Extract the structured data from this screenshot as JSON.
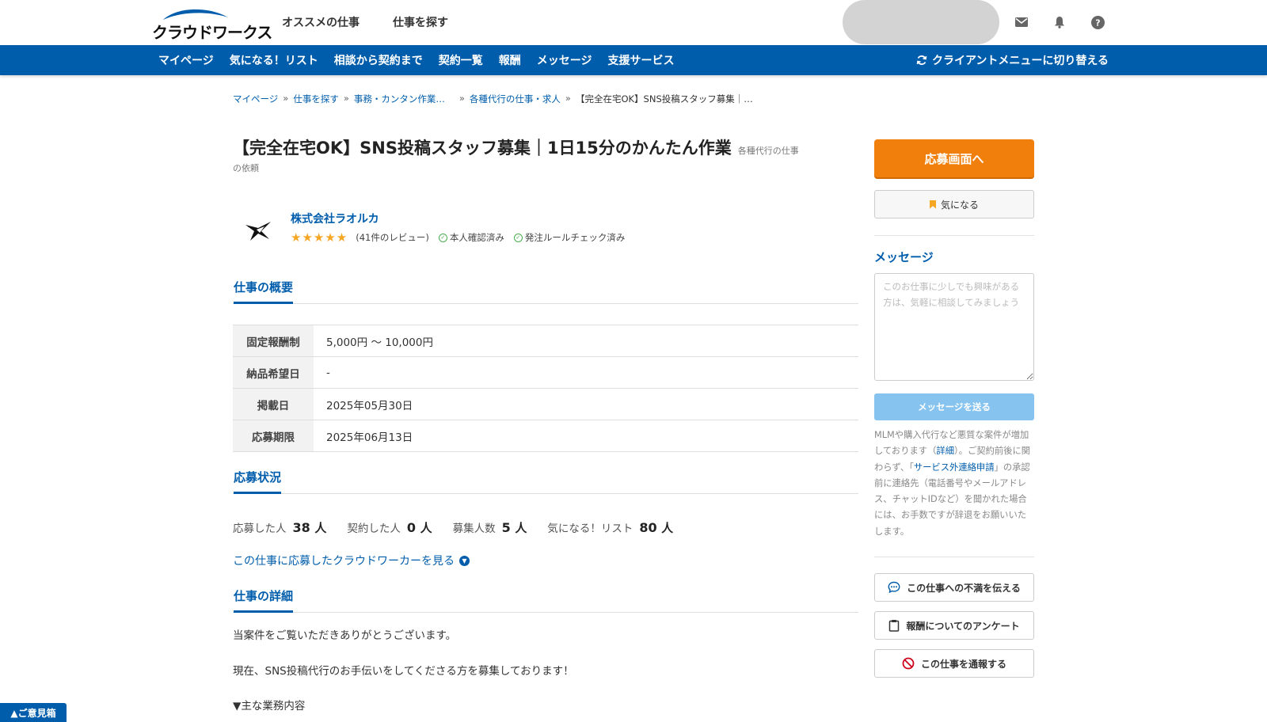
{
  "header": {
    "logo_text": "クラウドワークス",
    "nav": [
      "オススメの仕事",
      "仕事を探す"
    ]
  },
  "bluenav": {
    "items": [
      "マイページ",
      "気になる！リスト",
      "相談から契約まで",
      "契約一覧",
      "報酬",
      "メッセージ",
      "支援サービス"
    ],
    "switch_label": "クライアントメニューに切り替える"
  },
  "breadcrumb": {
    "items": [
      "マイページ",
      "仕事を探す",
      "事務・カンタン作業…",
      "各種代行の仕事・求人"
    ],
    "current": "【完全在宅OK】SNS投稿スタッフ募集｜…",
    "separator": "»"
  },
  "job": {
    "title": "【完全在宅OK】SNS投稿スタッフ募集｜1日15分のかんたん作業",
    "category_1": "各種代行の仕事",
    "category_2": "の依頼"
  },
  "client": {
    "name": "株式会社ラオルカ",
    "stars": "★★★★★",
    "rating": 5,
    "reviews": "(41件のレビュー)",
    "verified_1": "本人確認済み",
    "verified_2": "発注ルールチェック済み"
  },
  "summary": {
    "heading": "仕事の概要",
    "rows": [
      {
        "label": "固定報酬制",
        "value": "5,000円 〜 10,000円"
      },
      {
        "label": "納品希望日",
        "value": "-"
      },
      {
        "label": "掲載日",
        "value": "2025年05月30日"
      },
      {
        "label": "応募期限",
        "value": "2025年06月13日"
      }
    ]
  },
  "status": {
    "heading": "応募状況",
    "applied_label": "応募した人",
    "applied": "38",
    "applied_unit": "人",
    "contracted_label": "契約した人",
    "contracted": "0",
    "contracted_unit": "人",
    "recruit_label": "募集人数",
    "recruit": "5",
    "recruit_unit": "人",
    "fav_label": "気になる！リスト",
    "fav": "80",
    "fav_unit": "人",
    "view_link": "この仕事に応募したクラウドワーカーを見る"
  },
  "detail": {
    "heading": "仕事の詳細",
    "p1": "当案件をご覧いただきありがとうございます。",
    "p2": "現在、SNS投稿代行のお手伝いをしてくださる方を募集しております！",
    "p3": "▼主な業務内容"
  },
  "sidebar": {
    "apply": "応募画面へ",
    "favorite": "気になる",
    "message_title": "メッセージ",
    "message_placeholder": "このお仕事に少しでも興味がある方は、気軽に相談してみましょう",
    "send": "メッセージを送る",
    "notice_1": "MLMや購入代行など悪質な案件が増加しております（",
    "notice_link_1": "詳細",
    "notice_2": "）。ご契約前後に関わらず、「",
    "notice_link_2": "サービス外連絡申請",
    "notice_3": "」の承認前に連絡先（電話番号やメールアドレス、チャットIDなど）を聞かれた場合には、お手数ですが辞退をお願いいたします。",
    "complaint": "この仕事への不満を伝える",
    "survey": "報酬についてのアンケート",
    "report": "この仕事を通報する"
  },
  "feedback": "▲ご意見箱",
  "colors": {
    "brand_blue": "#005dab",
    "apply_orange": "#f07f0b",
    "star": "#f5a623"
  }
}
